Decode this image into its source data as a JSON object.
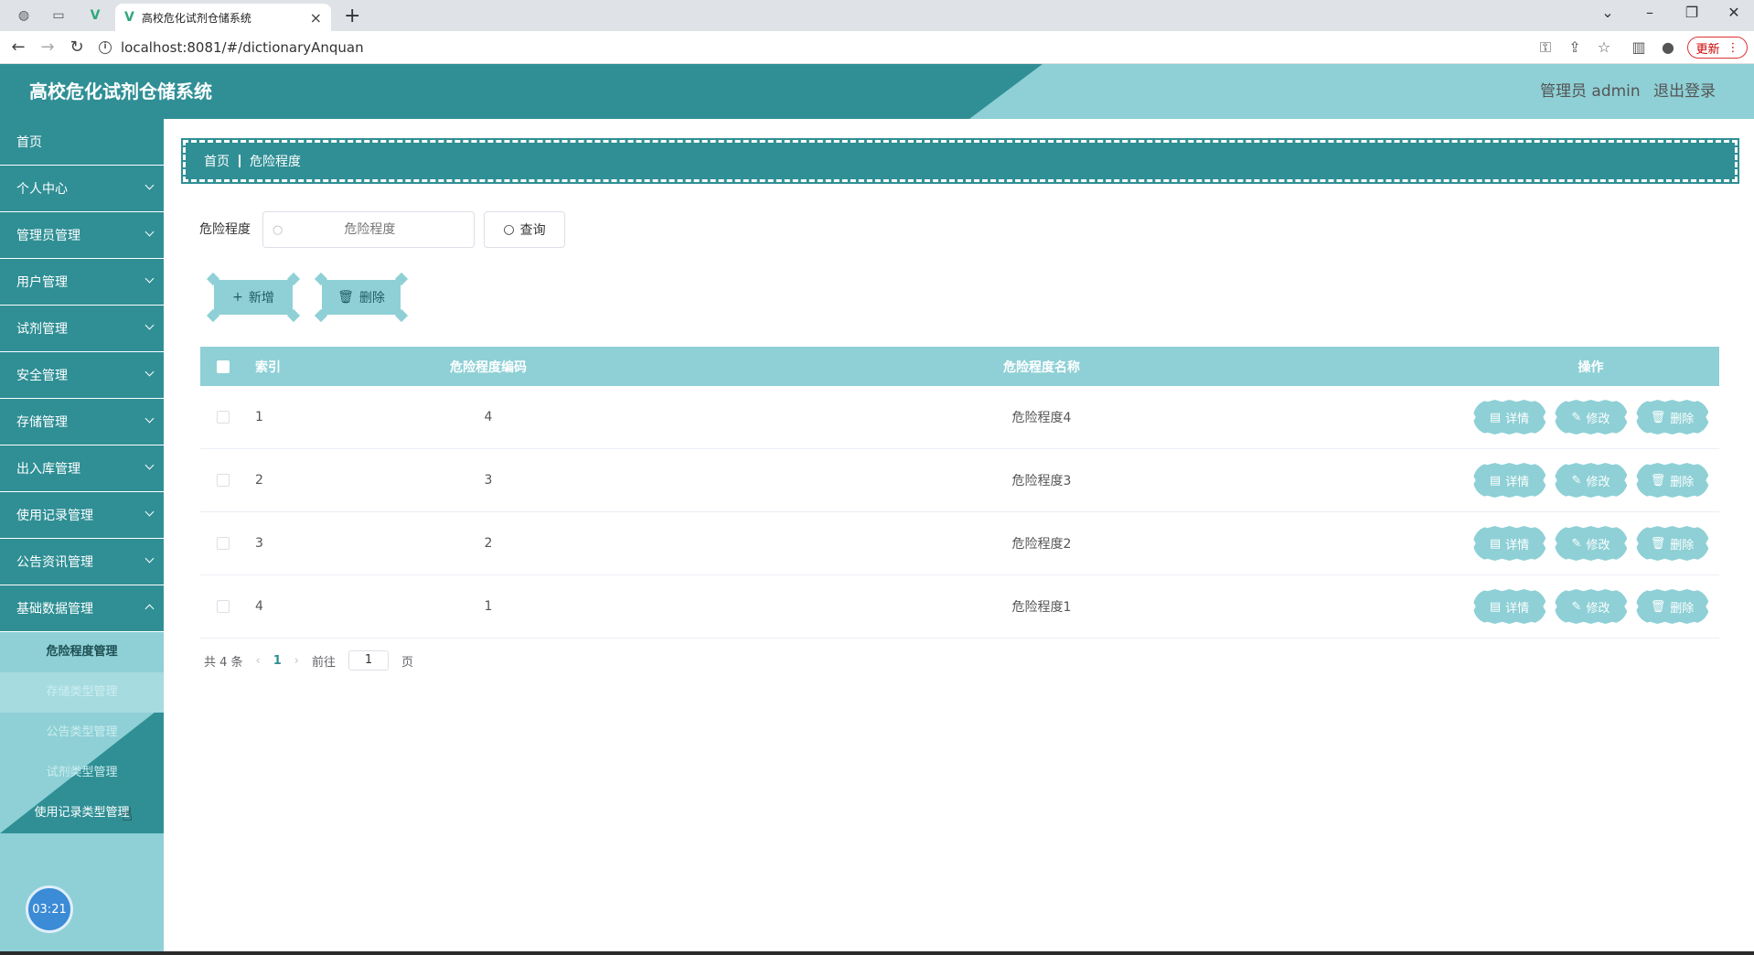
{
  "browser": {
    "tab_title": "高校危化试剂仓储系统",
    "url": "localhost:8081/#/dictionaryAnquan",
    "update_label": "更新"
  },
  "header": {
    "title": "高校危化试剂仓储系统",
    "user": "管理员 admin",
    "logout": "退出登录"
  },
  "sidebar": {
    "items": [
      {
        "label": "首页"
      },
      {
        "label": "个人中心"
      },
      {
        "label": "管理员管理"
      },
      {
        "label": "用户管理"
      },
      {
        "label": "试剂管理"
      },
      {
        "label": "安全管理"
      },
      {
        "label": "存储管理"
      },
      {
        "label": "出入库管理"
      },
      {
        "label": "使用记录管理"
      },
      {
        "label": "公告资讯管理"
      },
      {
        "label": "基础数据管理"
      }
    ],
    "sub_items": [
      {
        "label": "危险程度管理"
      },
      {
        "label": "存储类型管理"
      },
      {
        "label": "公告类型管理"
      },
      {
        "label": "试剂类型管理"
      },
      {
        "label": "使用记录类型管理"
      }
    ],
    "clock": "03:21"
  },
  "breadcrumb": {
    "home": "首页",
    "current": "危险程度"
  },
  "search": {
    "label": "危险程度",
    "placeholder": "危险程度",
    "query_label": "查询"
  },
  "actions": {
    "add_label": "新增",
    "delete_label": "删除"
  },
  "table": {
    "headers": {
      "index": "索引",
      "code": "危险程度编码",
      "name": "危险程度名称",
      "ops": "操作"
    },
    "rows": [
      {
        "index": "1",
        "code": "4",
        "name": "危险程度4"
      },
      {
        "index": "2",
        "code": "3",
        "name": "危险程度3"
      },
      {
        "index": "3",
        "code": "2",
        "name": "危险程度2"
      },
      {
        "index": "4",
        "code": "1",
        "name": "危险程度1"
      }
    ],
    "op_labels": {
      "detail": "详情",
      "edit": "修改",
      "delete": "删除"
    }
  },
  "pagination": {
    "total": "共 4 条",
    "current": "1",
    "goto": "前往",
    "page_value": "1",
    "page_suffix": "页"
  },
  "colors": {
    "primary": "#2f8f95",
    "light": "#8ed0d6"
  }
}
